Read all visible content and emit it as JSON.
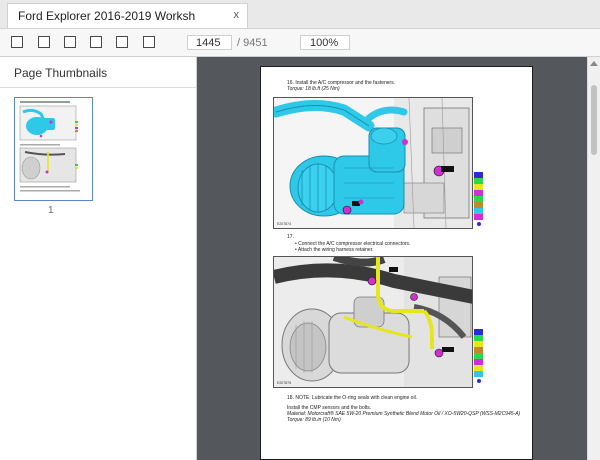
{
  "tab": {
    "title": "Ford Explorer 2016-2019 Worksh",
    "close": "x"
  },
  "toolbar": {
    "buttons": [
      "sidebar-toggle",
      "first-page",
      "previous-page",
      "next-page",
      "last-page",
      "fit-page"
    ],
    "page_current": "1445",
    "page_total": "/ 9451",
    "zoom": "100%"
  },
  "sidebar": {
    "title": "Page Thumbnails",
    "thumbnail_number": "1"
  },
  "document": {
    "step16_line1": "16. Install the A/C compressor and the fasteners.",
    "step16_torque": "Torque: 18 lb.ft (25 Nm)",
    "fig1_id": "E207874",
    "step17_num": "17.",
    "step17_b1": "Connect the A/C compressor electrical connectors.",
    "step17_b2": "Attach the wiring harness retainer.",
    "fig2_id": "E207875",
    "step18_note": "18. NOTE: Lubricate the O-ring seals with clean engine oil.",
    "step18_line2": "Install the CMP sensors and the bolts.",
    "step18_material": "Material: Motorcraft® SAE 5W-20 Premium Synthetic Blend Motor Oil / XO-5W20-QSP (WSS-M2C945-A)",
    "step18_torque": "Torque: 89 lb.in (10 Nm)"
  },
  "colors": {
    "compressor": "#2ec8e8",
    "fastener_highlight": "#d22ed2",
    "wiring_highlight": "#e6e61e",
    "viewer_background": "#54575b",
    "thumbnail_border": "#5b87c5"
  },
  "icons": {
    "toolbar": "square-button-icon",
    "scroll": "arrow-up-icon"
  }
}
